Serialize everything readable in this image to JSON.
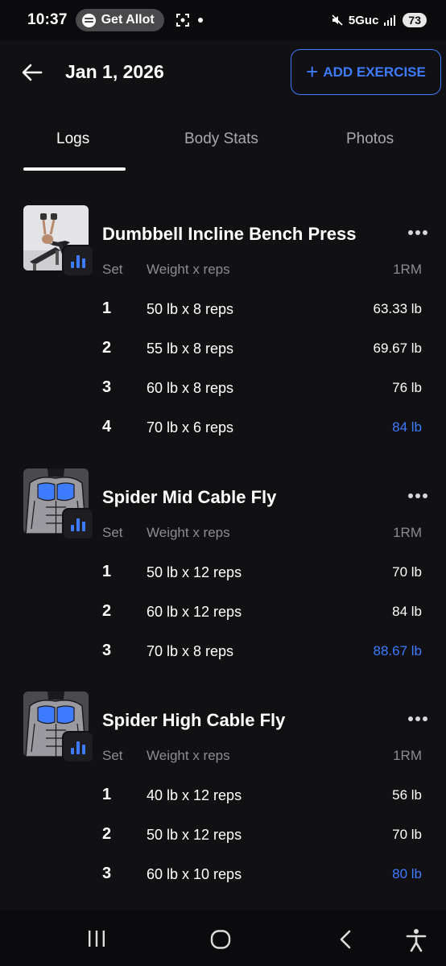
{
  "status_bar": {
    "time": "10:37",
    "notification_pill": "Get Allot",
    "network": "5Guc",
    "battery": "73"
  },
  "header": {
    "date": "Jan 1, 2026",
    "add_button_label": "ADD EXERCISE"
  },
  "tabs": [
    {
      "label": "Logs",
      "active": true
    },
    {
      "label": "Body Stats",
      "active": false
    },
    {
      "label": "Photos",
      "active": false
    }
  ],
  "columns": {
    "set": "Set",
    "weight_reps": "Weight x reps",
    "one_rm": "1RM"
  },
  "exercises": [
    {
      "name": "Dumbbell Incline Bench Press",
      "thumbnail": "person-incline-press-photo",
      "sets": [
        {
          "set": "1",
          "weight_reps": "50 lb x 8 reps",
          "one_rm": "63.33 lb",
          "best": false
        },
        {
          "set": "2",
          "weight_reps": "55 lb x 8 reps",
          "one_rm": "69.67 lb",
          "best": false
        },
        {
          "set": "3",
          "weight_reps": "60 lb x 8 reps",
          "one_rm": "76 lb",
          "best": false
        },
        {
          "set": "4",
          "weight_reps": "70 lb x 6 reps",
          "one_rm": "84 lb",
          "best": true
        }
      ]
    },
    {
      "name": "Spider Mid Cable Fly",
      "thumbnail": "chest-muscle-diagram",
      "sets": [
        {
          "set": "1",
          "weight_reps": "50 lb x 12 reps",
          "one_rm": "70 lb",
          "best": false
        },
        {
          "set": "2",
          "weight_reps": "60 lb x 12 reps",
          "one_rm": "84 lb",
          "best": false
        },
        {
          "set": "3",
          "weight_reps": "70 lb x 8 reps",
          "one_rm": "88.67 lb",
          "best": true
        }
      ]
    },
    {
      "name": "Spider High Cable Fly",
      "thumbnail": "chest-muscle-diagram",
      "sets": [
        {
          "set": "1",
          "weight_reps": "40 lb x 12 reps",
          "one_rm": "56 lb",
          "best": false
        },
        {
          "set": "2",
          "weight_reps": "50 lb x 12 reps",
          "one_rm": "70 lb",
          "best": false
        },
        {
          "set": "3",
          "weight_reps": "60 lb x 10 reps",
          "one_rm": "80 lb",
          "best": true
        }
      ]
    }
  ],
  "colors": {
    "accent": "#3d7bff",
    "background": "#111113",
    "muted_text": "#8c8c91"
  }
}
